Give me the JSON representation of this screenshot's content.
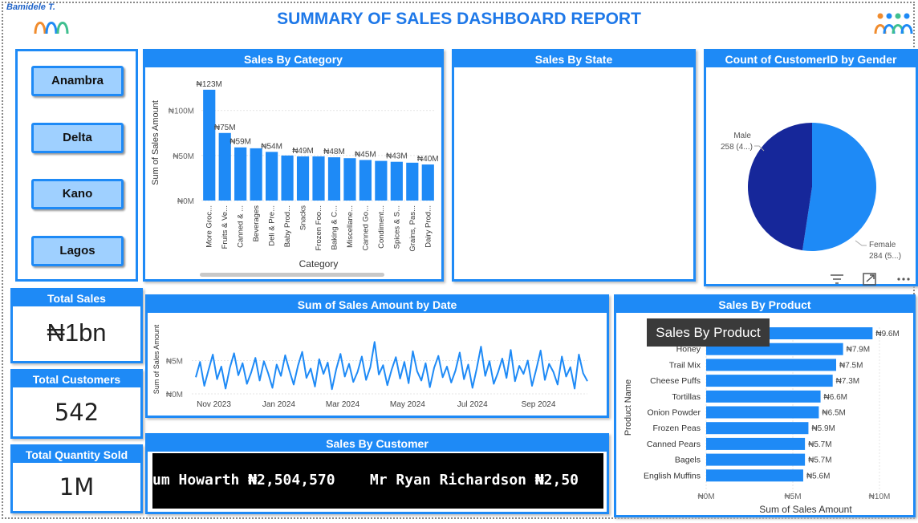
{
  "author": "Bamidele T.",
  "title": "SUMMARY OF SALES DASHBOARD REPORT",
  "slicer": {
    "states": [
      "Anambra",
      "Delta",
      "Kano",
      "Lagos"
    ]
  },
  "kpis": {
    "total_sales": {
      "label": "Total Sales",
      "value": "₦1bn"
    },
    "total_customers": {
      "label": "Total Customers",
      "value": "542"
    },
    "total_quantity": {
      "label": "Total Quantity Sold",
      "value": "1M"
    }
  },
  "panels": {
    "sales_by_state": "Sales By State",
    "sales_by_customer": "Sales By Customer"
  },
  "ticker_text": "um Howarth ₦2,504,570    Mr Ryan Richardson ₦2,50",
  "tooltip": "Sales By Product",
  "colors": {
    "accent": "#1e8af6",
    "dark_blue": "#16279a",
    "slicer_fill": "#9fd0ff"
  },
  "chart_data": [
    {
      "type": "bar",
      "title": "Sales By Category",
      "xlabel": "Category",
      "ylabel": "Sum of Sales Amount",
      "categories": [
        "More Groc...",
        "Fruits & Ve...",
        "Canned & ...",
        "Beverages",
        "Deli & Pre...",
        "Baby Prod...",
        "Snacks",
        "Frozen Foo...",
        "Baking & C...",
        "Miscellane...",
        "Canned Go...",
        "Condiment...",
        "Spices & S...",
        "Grains, Pas...",
        "Dairy Prod..."
      ],
      "values": [
        123,
        75,
        59,
        58,
        54,
        50,
        49,
        49,
        48,
        47,
        45,
        44,
        43,
        42,
        40
      ],
      "data_labels": [
        "₦123M",
        "₦75M",
        "₦59M",
        "",
        "₦54M",
        "",
        "₦49M",
        "",
        "₦48M",
        "",
        "₦45M",
        "",
        "₦43M",
        "",
        "₦40M"
      ],
      "yticks": [
        "₦0M",
        "₦50M",
        "₦100M"
      ],
      "ylim": [
        0,
        130
      ]
    },
    {
      "type": "pie",
      "title": "Count of CustomerID by Gender",
      "slices": [
        {
          "label": "Male",
          "detail": "258 (4...)",
          "value": 258,
          "color": "#16279a"
        },
        {
          "label": "Female",
          "detail": "284 (5...)",
          "value": 284,
          "color": "#1e8af6"
        }
      ]
    },
    {
      "type": "line",
      "title": "Sum of Sales Amount by Date",
      "ylabel": "Sum of Sales Amount",
      "xticks": [
        "Nov 2023",
        "Jan 2024",
        "Mar 2024",
        "May 2024",
        "Jul 2024",
        "Sep 2024"
      ],
      "yticks": [
        "₦0M",
        "₦5M"
      ],
      "ylim": [
        0,
        10
      ],
      "x": [
        "2023-10-15",
        "2023-10-19",
        "2023-10-23",
        "2023-10-27",
        "2023-10-31",
        "2023-11-04",
        "2023-11-08",
        "2023-11-12",
        "2023-11-16",
        "2023-11-20",
        "2023-11-24",
        "2023-11-28",
        "2023-12-02",
        "2023-12-06",
        "2023-12-10",
        "2023-12-14",
        "2023-12-18",
        "2023-12-22",
        "2023-12-26",
        "2023-12-30",
        "2024-01-03",
        "2024-01-07",
        "2024-01-11",
        "2024-01-15",
        "2024-01-19",
        "2024-01-23",
        "2024-01-27",
        "2024-01-31",
        "2024-02-04",
        "2024-02-08",
        "2024-02-12",
        "2024-02-16",
        "2024-02-20",
        "2024-02-24",
        "2024-02-28",
        "2024-03-03",
        "2024-03-07",
        "2024-03-11",
        "2024-03-15",
        "2024-03-19",
        "2024-03-23",
        "2024-03-27",
        "2024-03-31",
        "2024-04-04",
        "2024-04-08",
        "2024-04-12",
        "2024-04-16",
        "2024-04-20",
        "2024-04-24",
        "2024-04-28",
        "2024-05-02",
        "2024-05-06",
        "2024-05-10",
        "2024-05-14",
        "2024-05-18",
        "2024-05-22",
        "2024-05-26",
        "2024-05-30",
        "2024-06-03",
        "2024-06-07",
        "2024-06-11",
        "2024-06-15",
        "2024-06-19",
        "2024-06-23",
        "2024-06-27",
        "2024-07-01",
        "2024-07-05",
        "2024-07-09",
        "2024-07-13",
        "2024-07-17",
        "2024-07-21",
        "2024-07-25",
        "2024-07-29",
        "2024-08-02",
        "2024-08-06",
        "2024-08-10",
        "2024-08-14",
        "2024-08-18",
        "2024-08-22",
        "2024-08-26",
        "2024-08-30",
        "2024-09-03",
        "2024-09-07",
        "2024-09-11",
        "2024-09-15",
        "2024-09-19",
        "2024-09-23",
        "2024-09-27",
        "2024-10-01",
        "2024-10-05",
        "2024-10-09",
        "2024-10-13",
        "2024-10-17"
      ],
      "values": [
        2.5,
        4.8,
        1.2,
        3.6,
        5.9,
        2.2,
        4.1,
        0.8,
        3.9,
        6.1,
        2.8,
        4.6,
        1.5,
        3.2,
        5.4,
        2.0,
        4.9,
        3.1,
        0.9,
        4.4,
        2.7,
        5.8,
        3.5,
        1.4,
        4.2,
        6.3,
        2.4,
        3.8,
        1.1,
        5.2,
        3.0,
        4.7,
        0.7,
        3.7,
        6.0,
        2.6,
        4.5,
        1.8,
        3.3,
        5.6,
        2.1,
        4.0,
        7.8,
        2.9,
        4.3,
        1.3,
        3.6,
        5.5,
        2.3,
        4.8,
        1.6,
        6.4,
        3.4,
        2.0,
        4.6,
        1.0,
        3.9,
        5.7,
        2.5,
        4.1,
        1.7,
        3.5,
        6.2,
        2.2,
        4.4,
        0.9,
        3.8,
        7.1,
        2.7,
        4.9,
        1.5,
        3.2,
        5.3,
        2.4,
        6.6,
        1.9,
        4.2,
        3.0,
        5.0,
        1.2,
        3.7,
        6.5,
        2.1,
        4.5,
        3.3,
        1.4,
        5.6,
        2.6,
        4.0,
        0.8,
        5.9,
        3.1,
        1.9
      ]
    },
    {
      "type": "bar",
      "orientation": "horizontal",
      "title": "Sales By Product",
      "xlabel": "Sum of Sales Amount",
      "ylabel": "Product Name",
      "categories": [
        "",
        "Honey",
        "Trail Mix",
        "Cheese Puffs",
        "Tortillas",
        "Onion Powder",
        "Frozen Peas",
        "Canned Pears",
        "Bagels",
        "English Muffins"
      ],
      "values": [
        9.6,
        7.9,
        7.5,
        7.3,
        6.6,
        6.5,
        5.9,
        5.7,
        5.7,
        5.6
      ],
      "data_labels": [
        "₦9.6M",
        "₦7.9M",
        "₦7.5M",
        "₦7.3M",
        "₦6.6M",
        "₦6.5M",
        "₦5.9M",
        "₦5.7M",
        "₦5.7M",
        "₦5.6M"
      ],
      "xticks": [
        "₦0M",
        "₦5M",
        "₦10M"
      ],
      "xlim": [
        0,
        10
      ]
    }
  ]
}
